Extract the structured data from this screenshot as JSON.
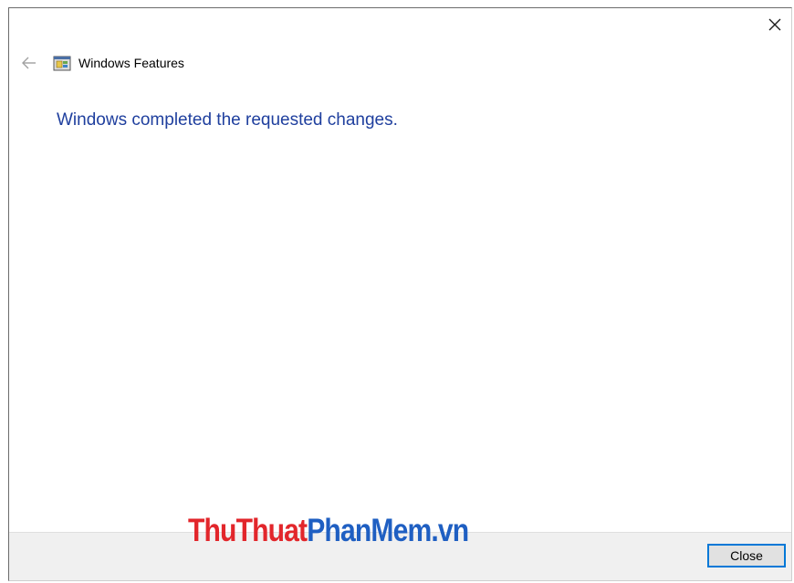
{
  "window": {
    "close_glyph": "✕"
  },
  "header": {
    "back_icon": "back-arrow-icon",
    "app_icon": "windows-features-icon",
    "title": "Windows Features"
  },
  "main": {
    "message": "Windows completed the requested changes."
  },
  "footer": {
    "close_label": "Close"
  },
  "watermark": {
    "part1": "ThuThuat",
    "part2": "PhanMem",
    "part3": ".vn"
  },
  "colors": {
    "message": "#1f3f9e",
    "button_border": "#0078d7",
    "footer_bg": "#f0f0f0",
    "watermark_red": "#e2262b",
    "watermark_blue": "#1f5fc2"
  }
}
